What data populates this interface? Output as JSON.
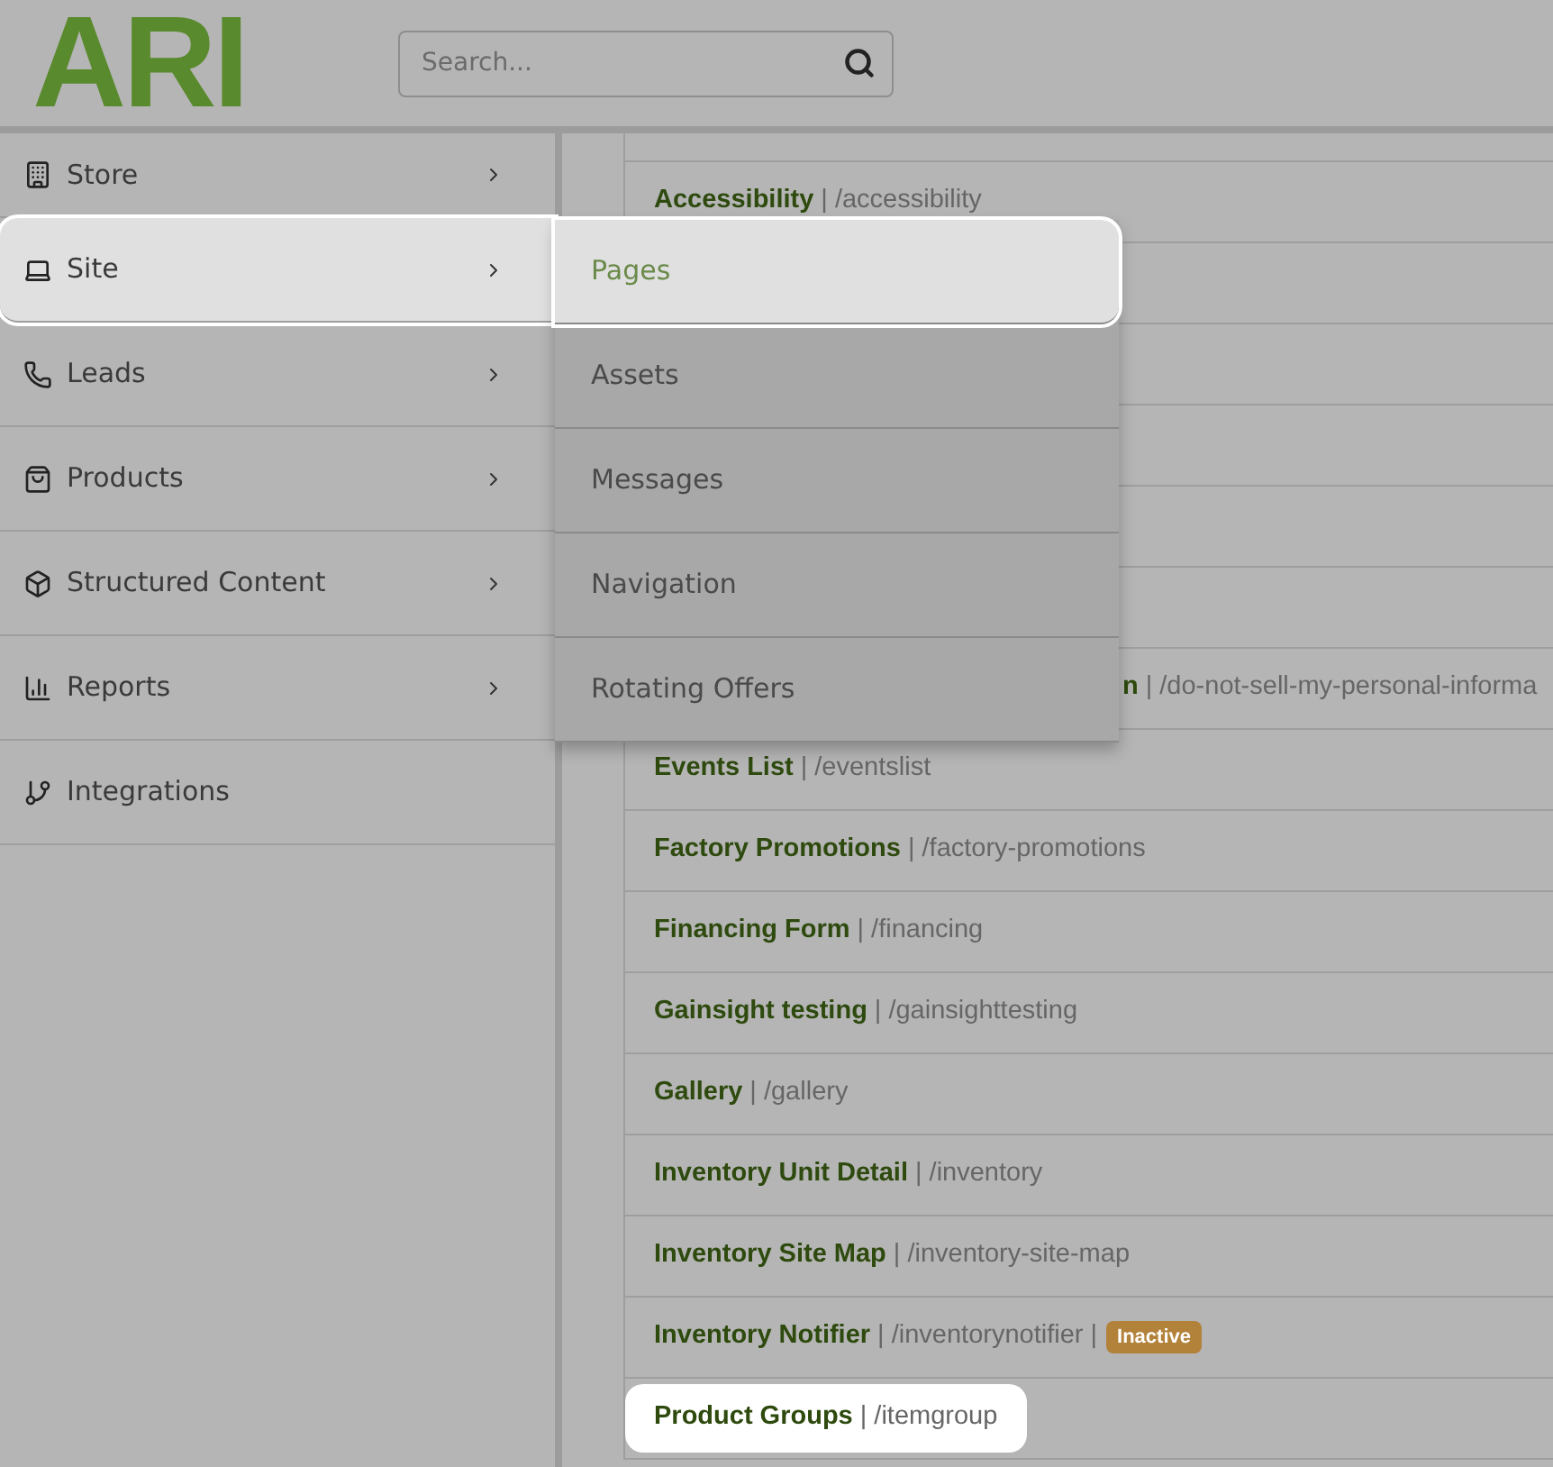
{
  "header": {
    "logo": "ARI",
    "search": {
      "placeholder": "Search..."
    }
  },
  "sidebar": {
    "items": [
      {
        "label": "Store",
        "has_submenu": true,
        "highlighted": false
      },
      {
        "label": "Site",
        "has_submenu": true,
        "highlighted": true
      },
      {
        "label": "Leads",
        "has_submenu": true,
        "highlighted": false
      },
      {
        "label": "Products",
        "has_submenu": true,
        "highlighted": false
      },
      {
        "label": "Structured Content",
        "has_submenu": true,
        "highlighted": false
      },
      {
        "label": "Reports",
        "has_submenu": true,
        "highlighted": false
      },
      {
        "label": "Integrations",
        "has_submenu": false,
        "highlighted": false
      }
    ]
  },
  "submenu": {
    "items": [
      {
        "label": "Pages",
        "highlighted": true
      },
      {
        "label": "Assets",
        "highlighted": false
      },
      {
        "label": "Messages",
        "highlighted": false
      },
      {
        "label": "Navigation",
        "highlighted": false
      },
      {
        "label": "Rotating Offers",
        "highlighted": false
      }
    ]
  },
  "pages": [
    {
      "kind": "full",
      "title": "Accessibility",
      "path": "| /accessibility",
      "highlighted": false
    },
    {
      "kind": "covered"
    },
    {
      "kind": "covered"
    },
    {
      "kind": "covered"
    },
    {
      "kind": "covered"
    },
    {
      "kind": "covered"
    },
    {
      "kind": "partial",
      "title": "n",
      "path": "| /do-not-sell-my-personal-informa",
      "highlighted": false
    },
    {
      "kind": "full",
      "title": "Events List",
      "path": "| /eventslist",
      "highlighted": false
    },
    {
      "kind": "full",
      "title": "Factory Promotions",
      "path": "| /factory-promotions",
      "highlighted": false
    },
    {
      "kind": "full",
      "title": "Financing Form",
      "path": "| /financing",
      "highlighted": false
    },
    {
      "kind": "full",
      "title": "Gainsight testing",
      "path": "| /gainsighttesting",
      "highlighted": false
    },
    {
      "kind": "full",
      "title": "Gallery",
      "path": "| /gallery",
      "highlighted": false
    },
    {
      "kind": "full",
      "title": "Inventory Unit Detail",
      "path": "| /inventory",
      "highlighted": false
    },
    {
      "kind": "full",
      "title": "Inventory Site Map",
      "path": "| /inventory-site-map",
      "highlighted": false
    },
    {
      "kind": "full",
      "title": "Inventory Notifier",
      "path": "| /inventorynotifier |",
      "badge": "Inactive",
      "highlighted": false
    },
    {
      "kind": "full",
      "title": "Product Groups",
      "path": "| /itemgroup",
      "highlighted": true
    }
  ]
}
